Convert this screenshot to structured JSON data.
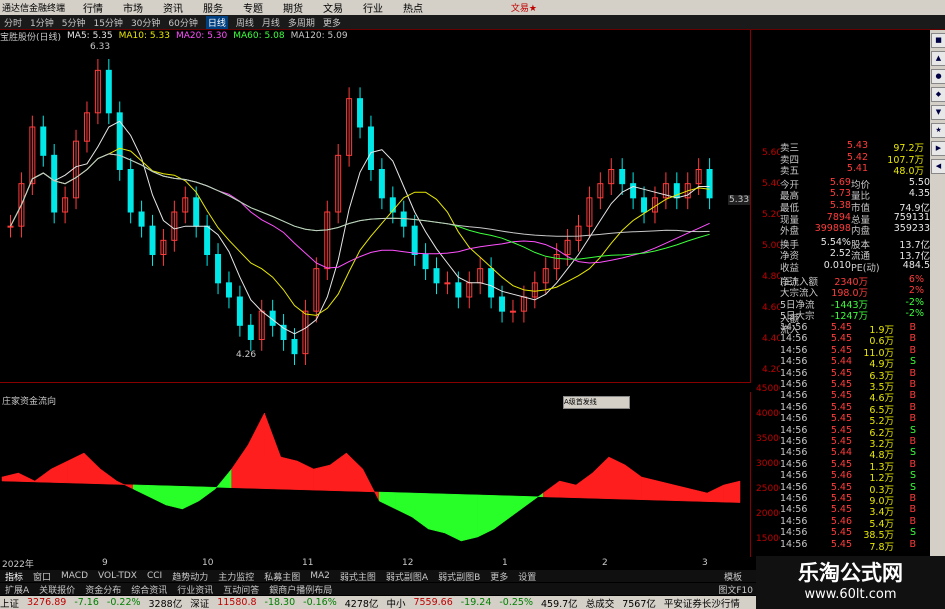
{
  "menubar": {
    "app_title": "通达信金融终端",
    "items": [
      "行情",
      "市场",
      "资讯",
      "服务",
      "专题",
      "期货",
      "文易",
      "行业",
      "热点"
    ],
    "right_text": "文易★"
  },
  "periodbar": {
    "items": [
      "分时",
      "1分钟",
      "5分钟",
      "15分钟",
      "30分钟",
      "60分钟",
      "日线",
      "周线",
      "月线",
      "多周期",
      "更多"
    ],
    "active": "日线"
  },
  "ma_legend": {
    "stock": "宝胜股份(日线)",
    "items": [
      {
        "label": "MA5: 5.35",
        "color": "#e6e6e6"
      },
      {
        "label": "MA10: 5.33",
        "color": "#e8e800"
      },
      {
        "label": "MA20: 5.30",
        "color": "#ff50ff"
      },
      {
        "label": "MA60: 5.08",
        "color": "#3cff3c"
      },
      {
        "label": "MA120: 5.09",
        "color": "#c8c8c8"
      }
    ]
  },
  "main_chart": {
    "high_label": "6.33",
    "low_label": "4.26",
    "last_label": "5.33",
    "y_ticks": [
      "5.60",
      "5.40",
      "5.20",
      "5.00",
      "4.80",
      "4.60",
      "4.40",
      "4.20"
    ]
  },
  "sub_chart": {
    "title": "庄家资金流向",
    "y_ticks": [
      "45000",
      "40000",
      "35000",
      "30000",
      "25000",
      "20000",
      "15000"
    ],
    "tooltip": "A级首发线"
  },
  "quote": {
    "asks": [
      {
        "label": "卖三",
        "price": "5.43",
        "vol": "97.2万"
      },
      {
        "label": "卖四",
        "price": "5.42",
        "vol": "107.7万"
      },
      {
        "label": "卖五",
        "price": "5.41",
        "vol": "48.0万"
      }
    ],
    "stats": [
      {
        "l1": "今开",
        "v1": "5.69",
        "l2": "均价",
        "v2": "5.50"
      },
      {
        "l1": "最高",
        "v1": "5.73",
        "l2": "量比",
        "v2": "4.35"
      },
      {
        "l1": "最低",
        "v1": "5.38",
        "l2": "市值",
        "v2": "74.9亿"
      },
      {
        "l1": "现量",
        "v1": "7894",
        "l2": "总量",
        "v2": "759131"
      },
      {
        "l1": "外盘",
        "v1": "399898",
        "l2": "内盘",
        "v2": "359233"
      }
    ],
    "stats2": [
      {
        "l1": "换手",
        "v1": "5.54%",
        "l2": "股本",
        "v2": "13.7亿"
      },
      {
        "l1": "净资",
        "v1": "2.52",
        "l2": "流通",
        "v2": "13.7亿"
      },
      {
        "l1": "收益(三)",
        "v1": "0.010",
        "l2": "PE(动)",
        "v2": "484.5"
      }
    ],
    "flows": [
      {
        "label": "净流入额",
        "value": "2340万",
        "pct": "6%",
        "color": "#ff3c3c"
      },
      {
        "label": "大宗流入",
        "value": "198.0万",
        "pct": "2%",
        "color": "#ff3c3c"
      },
      {
        "label": "5日净流入额",
        "value": "-1443万",
        "pct": "-2%",
        "color": "#3cff3c"
      },
      {
        "label": "5日大宗流入",
        "value": "-1247万",
        "pct": "-2%",
        "color": "#3cff3c"
      }
    ],
    "ticks": [
      {
        "t": "14:56",
        "p": "5.45",
        "v": "1.9万",
        "s": "B"
      },
      {
        "t": "14:56",
        "p": "5.45",
        "v": "0.6万",
        "s": "B"
      },
      {
        "t": "14:56",
        "p": "5.45",
        "v": "11.0万",
        "s": "B"
      },
      {
        "t": "14:56",
        "p": "5.44",
        "v": "4.9万",
        "s": "S"
      },
      {
        "t": "14:56",
        "p": "5.45",
        "v": "6.3万",
        "s": "B"
      },
      {
        "t": "14:56",
        "p": "5.45",
        "v": "3.5万",
        "s": "B"
      },
      {
        "t": "14:56",
        "p": "5.45",
        "v": "4.6万",
        "s": "B"
      },
      {
        "t": "14:56",
        "p": "5.45",
        "v": "6.5万",
        "s": "B"
      },
      {
        "t": "14:56",
        "p": "5.45",
        "v": "5.2万",
        "s": "B"
      },
      {
        "t": "14:56",
        "p": "5.45",
        "v": "6.2万",
        "s": "S"
      },
      {
        "t": "14:56",
        "p": "5.45",
        "v": "3.2万",
        "s": "B"
      },
      {
        "t": "14:56",
        "p": "5.44",
        "v": "4.8万",
        "s": "S"
      },
      {
        "t": "14:56",
        "p": "5.45",
        "v": "1.3万",
        "s": "B"
      },
      {
        "t": "14:56",
        "p": "5.46",
        "v": "1.2万",
        "s": "S"
      },
      {
        "t": "14:56",
        "p": "5.45",
        "v": "0.3万",
        "s": "S"
      },
      {
        "t": "14:56",
        "p": "5.45",
        "v": "9.0万",
        "s": "B"
      },
      {
        "t": "14:56",
        "p": "5.45",
        "v": "3.4万",
        "s": "B"
      },
      {
        "t": "14:56",
        "p": "5.46",
        "v": "5.4万",
        "s": "B"
      },
      {
        "t": "14:56",
        "p": "5.45",
        "v": "38.5万",
        "s": "S"
      },
      {
        "t": "14:56",
        "p": "5.45",
        "v": "7.8万",
        "s": "B"
      }
    ]
  },
  "datebar": {
    "labels": [
      "2022年",
      "9",
      "10",
      "11",
      "12",
      "1",
      "2",
      "3"
    ]
  },
  "tabbar": {
    "items": [
      "指标",
      "窗口",
      "MACD",
      "VOL-TDX",
      "CCI",
      "趋势动力",
      "主力监控",
      "私募主图",
      "MA2",
      "弱式主图",
      "弱式副图A",
      "弱式副图B",
      "更多",
      "设置"
    ],
    "items2": [
      "扩展A",
      "关联报价",
      "资金分布",
      "综合资讯",
      "行业资讯",
      "互动问答",
      "銀商户播例布局"
    ],
    "board": "模板",
    "tpl": "图文F10"
  },
  "statusbar": {
    "segments": [
      {
        "text": "上证",
        "color": "#000"
      },
      {
        "text": "3276.89",
        "color": "#c00000"
      },
      {
        "text": "-7.16",
        "color": "#008000"
      },
      {
        "text": "-0.22%",
        "color": "#008000"
      },
      {
        "text": "3288亿",
        "color": "#000"
      },
      {
        "text": "深证",
        "color": "#000"
      },
      {
        "text": "11580.8",
        "color": "#c00000"
      },
      {
        "text": "-18.30",
        "color": "#008000"
      },
      {
        "text": "-0.16%",
        "color": "#008000"
      },
      {
        "text": "4278亿",
        "color": "#000"
      },
      {
        "text": "中小",
        "color": "#000"
      },
      {
        "text": "7559.66",
        "color": "#c00000"
      },
      {
        "text": "-19.24",
        "color": "#008000"
      },
      {
        "text": "-0.25%",
        "color": "#008000"
      },
      {
        "text": "459.7亿",
        "color": "#000"
      },
      {
        "text": "总成交",
        "color": "#000"
      },
      {
        "text": "7567亿",
        "color": "#000"
      },
      {
        "text": "平安证券长沙行情",
        "color": "#000"
      }
    ]
  },
  "watermark": {
    "cn": "乐淘公式网",
    "url": "www.60lt.com"
  },
  "colors": {
    "up": "#ff3c3c",
    "down": "#00e8e8",
    "flow_up": "#ff1e1e",
    "flow_down": "#28ff28"
  }
}
